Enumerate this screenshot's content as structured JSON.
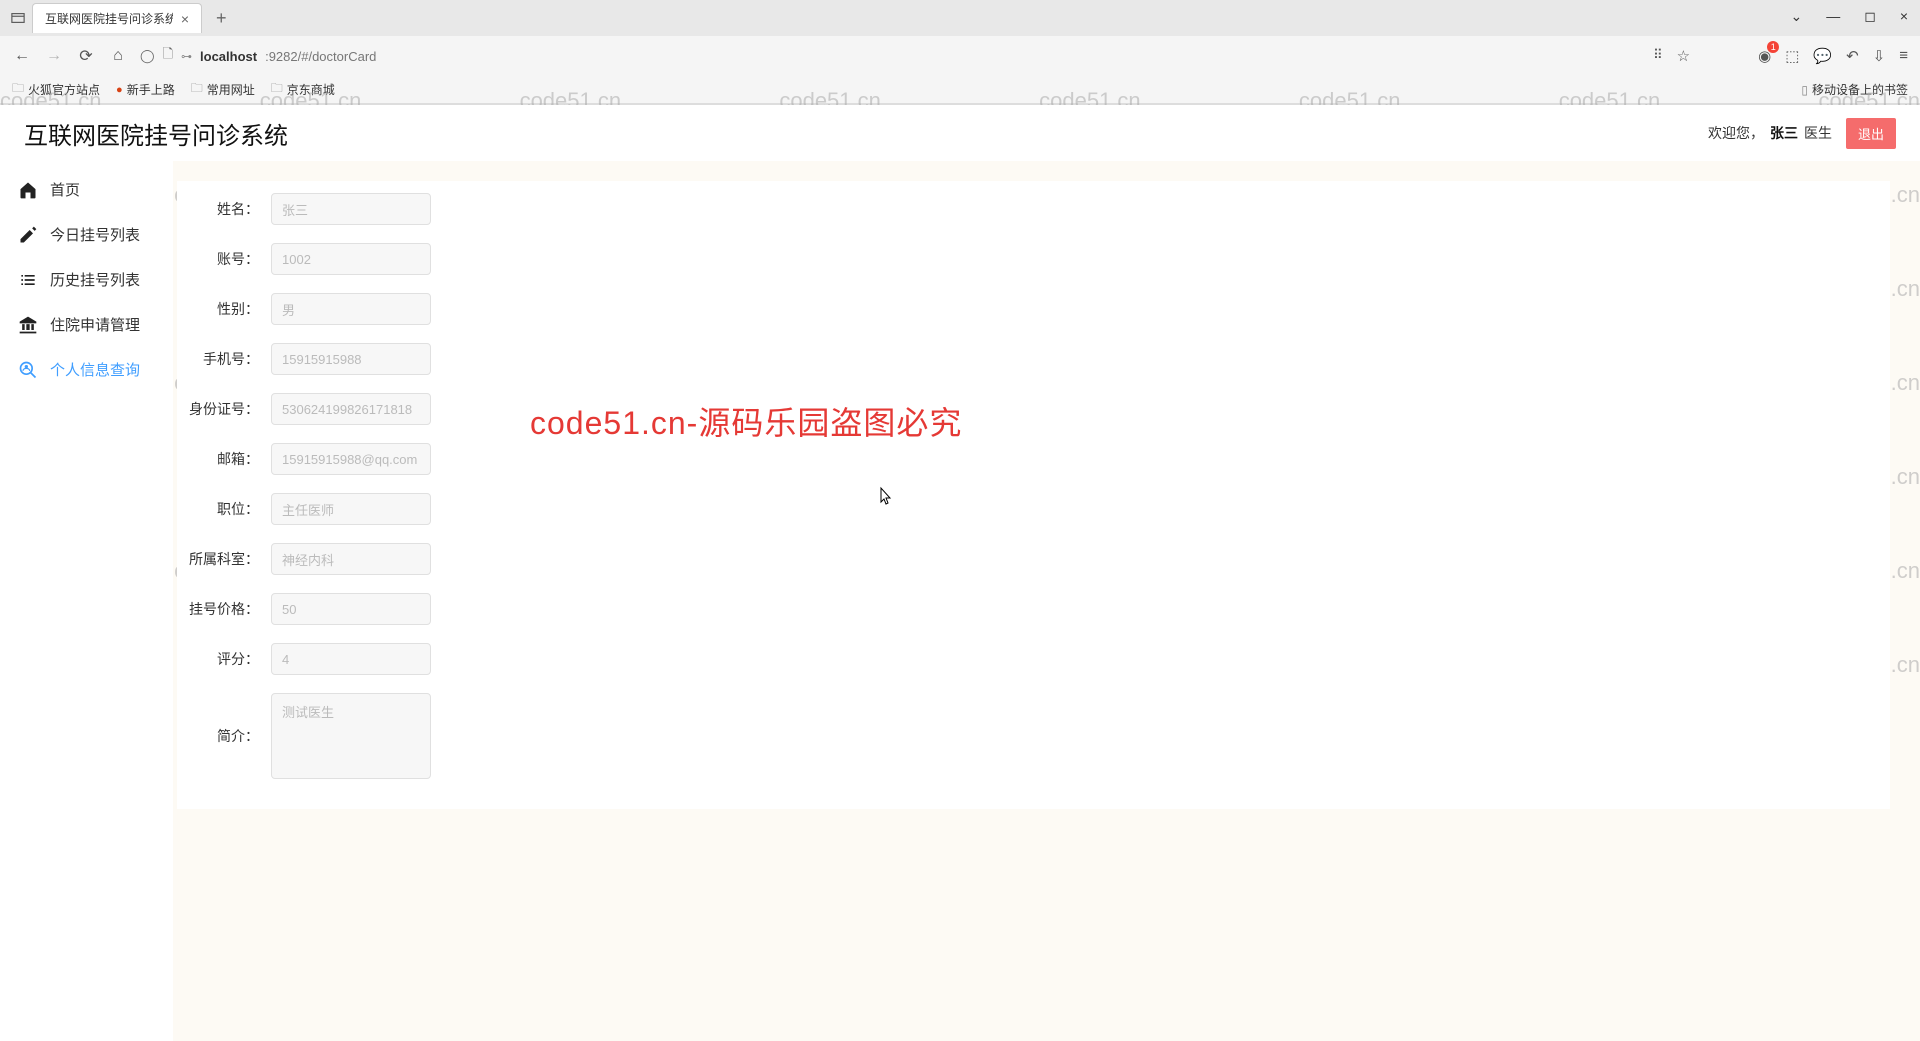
{
  "browser": {
    "tab_title": "互联网医院挂号问诊系统",
    "url_prefix": "localhost",
    "url_suffix": ":9282/#/doctorCard"
  },
  "bookmarks": {
    "b1": "火狐官方站点",
    "b2": "新手上路",
    "b3": "常用网址",
    "b4": "京东商城",
    "mobile": "移动设备上的书签"
  },
  "header": {
    "title": "互联网医院挂号问诊系统",
    "welcome": "欢迎您，",
    "username": "张三",
    "role": "医生",
    "logout": "退出"
  },
  "sidebar": {
    "items": [
      {
        "label": "首页"
      },
      {
        "label": "今日挂号列表"
      },
      {
        "label": "历史挂号列表"
      },
      {
        "label": "住院申请管理"
      },
      {
        "label": "个人信息查询"
      }
    ]
  },
  "form": {
    "name": {
      "label": "姓名：",
      "value": "张三"
    },
    "account": {
      "label": "账号：",
      "value": "1002"
    },
    "gender": {
      "label": "性别：",
      "value": "男"
    },
    "phone": {
      "label": "手机号：",
      "value": "15915915988"
    },
    "idcard": {
      "label": "身份证号：",
      "value": "530624199826171818"
    },
    "email": {
      "label": "邮箱：",
      "value": "15915915988@qq.com"
    },
    "position": {
      "label": "职位：",
      "value": "主任医师"
    },
    "department": {
      "label": "所属科室：",
      "value": "神经内科"
    },
    "price": {
      "label": "挂号价格：",
      "value": "50"
    },
    "rating": {
      "label": "评分：",
      "value": "4"
    },
    "intro": {
      "label": "简介：",
      "value": "测试医生"
    }
  },
  "watermark": "code51.cn",
  "red_text": "code51.cn-源码乐园盗图必究"
}
